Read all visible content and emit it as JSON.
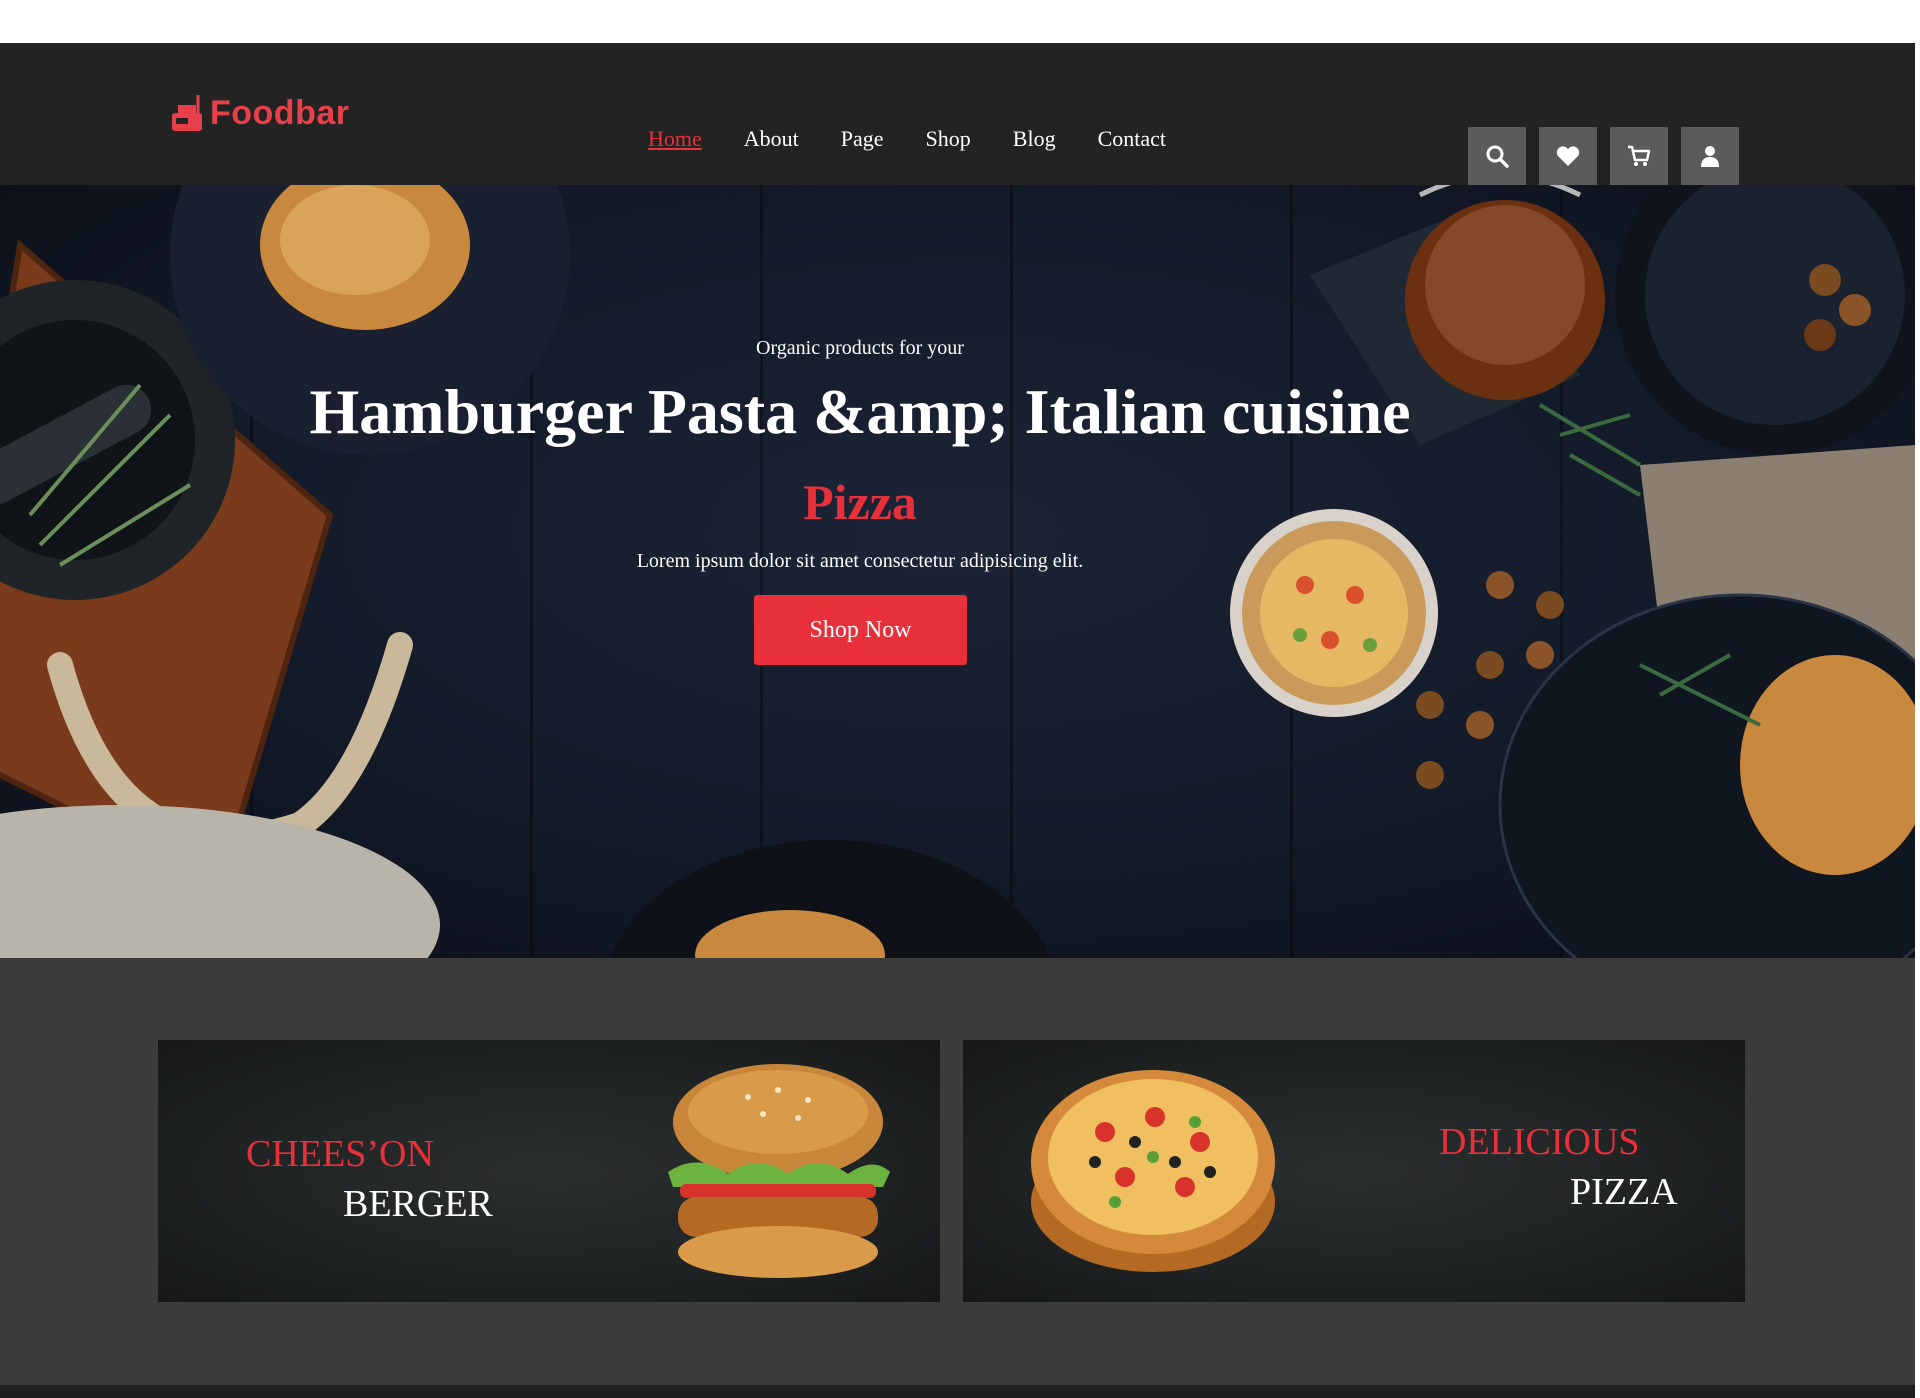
{
  "brand": {
    "name": "Foodbar",
    "color": "#e8404a"
  },
  "nav": {
    "items": [
      {
        "label": "Home",
        "active": true
      },
      {
        "label": "About",
        "active": false
      },
      {
        "label": "Page",
        "active": false
      },
      {
        "label": "Shop",
        "active": false
      },
      {
        "label": "Blog",
        "active": false
      },
      {
        "label": "Contact",
        "active": false
      }
    ],
    "icons": [
      "search-icon",
      "heart-icon",
      "cart-icon",
      "user-icon"
    ]
  },
  "hero": {
    "subtitle": "Organic products for your",
    "title": "Hamburger Pasta &amp; Italian cuisine",
    "accent": "Pizza",
    "description": "Lorem ipsum dolor sit amet consectetur adipisicing elit.",
    "button_label": "Shop Now"
  },
  "promos": [
    {
      "line1": "CHEES’ON",
      "line2": "BERGER"
    },
    {
      "line1": "DELICIOUS",
      "line2": "PIZZA"
    }
  ],
  "colors": {
    "accent": "#e8303a",
    "navbar_bg": "#232323",
    "icon_button_bg": "#5b5b5b",
    "promo_section_bg": "#3c3c3c"
  }
}
